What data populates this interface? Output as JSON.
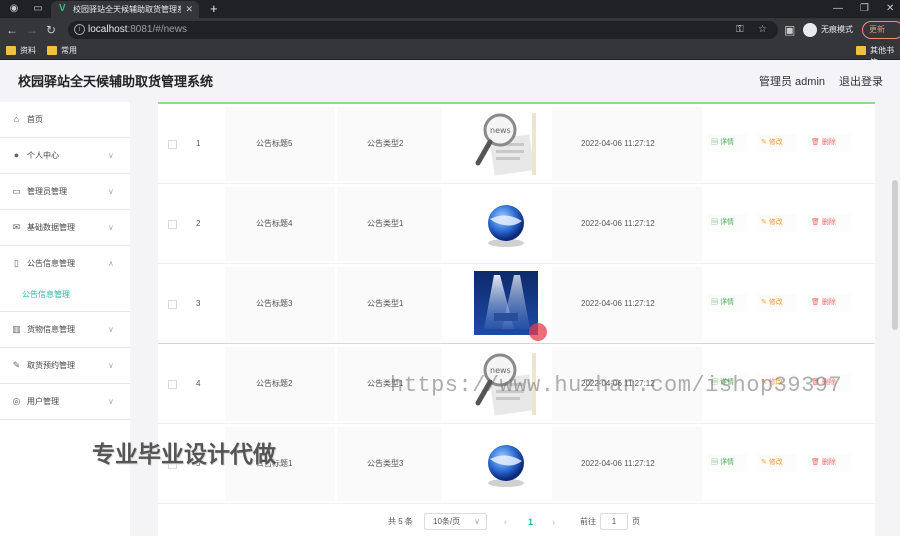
{
  "browser": {
    "tab_title": "校园驿站全天候辅助取货管理系统",
    "url_host": "localhost",
    "url_rest": ":8081/#/news",
    "incognito_label": "无痕模式",
    "update_label": "更新",
    "bookmarks": [
      "资料",
      "常用"
    ],
    "other_bookmarks": "其他书签"
  },
  "header": {
    "app_title": "校园驿站全天候辅助取货管理系统",
    "admin_label": "管理员 admin",
    "logout_label": "退出登录"
  },
  "sidebar": {
    "items": [
      {
        "label": "首页",
        "icon": "home-icon"
      },
      {
        "label": "个人中心",
        "icon": "user-icon"
      },
      {
        "label": "管理员管理",
        "icon": "chat-icon"
      },
      {
        "label": "基础数据管理",
        "icon": "mail-icon"
      },
      {
        "label": "公告信息管理",
        "icon": "mic-icon"
      },
      {
        "label": "货物信息管理",
        "icon": "chart-icon"
      },
      {
        "label": "取货预约管理",
        "icon": "pen-icon"
      },
      {
        "label": "用户管理",
        "icon": "compass-icon"
      }
    ],
    "active_submenu": "公告信息管理"
  },
  "table": {
    "rows": [
      {
        "index": "1",
        "title": "公告标题5",
        "type": "公告类型2",
        "image": "news-magnifier",
        "time": "2022-04-06 11:27:12"
      },
      {
        "index": "2",
        "title": "公告标题4",
        "type": "公告类型1",
        "image": "blue-globe",
        "time": "2022-04-06 11:27:12"
      },
      {
        "index": "3",
        "title": "公告标题3",
        "type": "公告类型1",
        "image": "stage-lights",
        "time": "2022-04-06 11:27:12"
      },
      {
        "index": "4",
        "title": "公告标题2",
        "type": "公告类型1",
        "image": "news-magnifier",
        "time": "2022-04-06 11:27:12"
      },
      {
        "index": "5",
        "title": "公告标题1",
        "type": "公告类型3",
        "image": "blue-globe",
        "time": "2022-04-06 11:27:12"
      }
    ],
    "actions": {
      "detail": "详情",
      "edit": "修改",
      "delete": "删除"
    }
  },
  "pagination": {
    "total": "共 5 条",
    "page_size": "10条/页",
    "current_page": "1",
    "goto_label": "前往",
    "goto_value": "1",
    "page_suffix": "页"
  },
  "overlays": {
    "watermark": "https://www.huzhan.com/ishop39397",
    "promo": "专业毕业设计代做"
  },
  "colors": {
    "accent": "#2fb8a8",
    "detail": "#4caf50",
    "edit": "#f0a020",
    "delete": "#f56c6c"
  }
}
